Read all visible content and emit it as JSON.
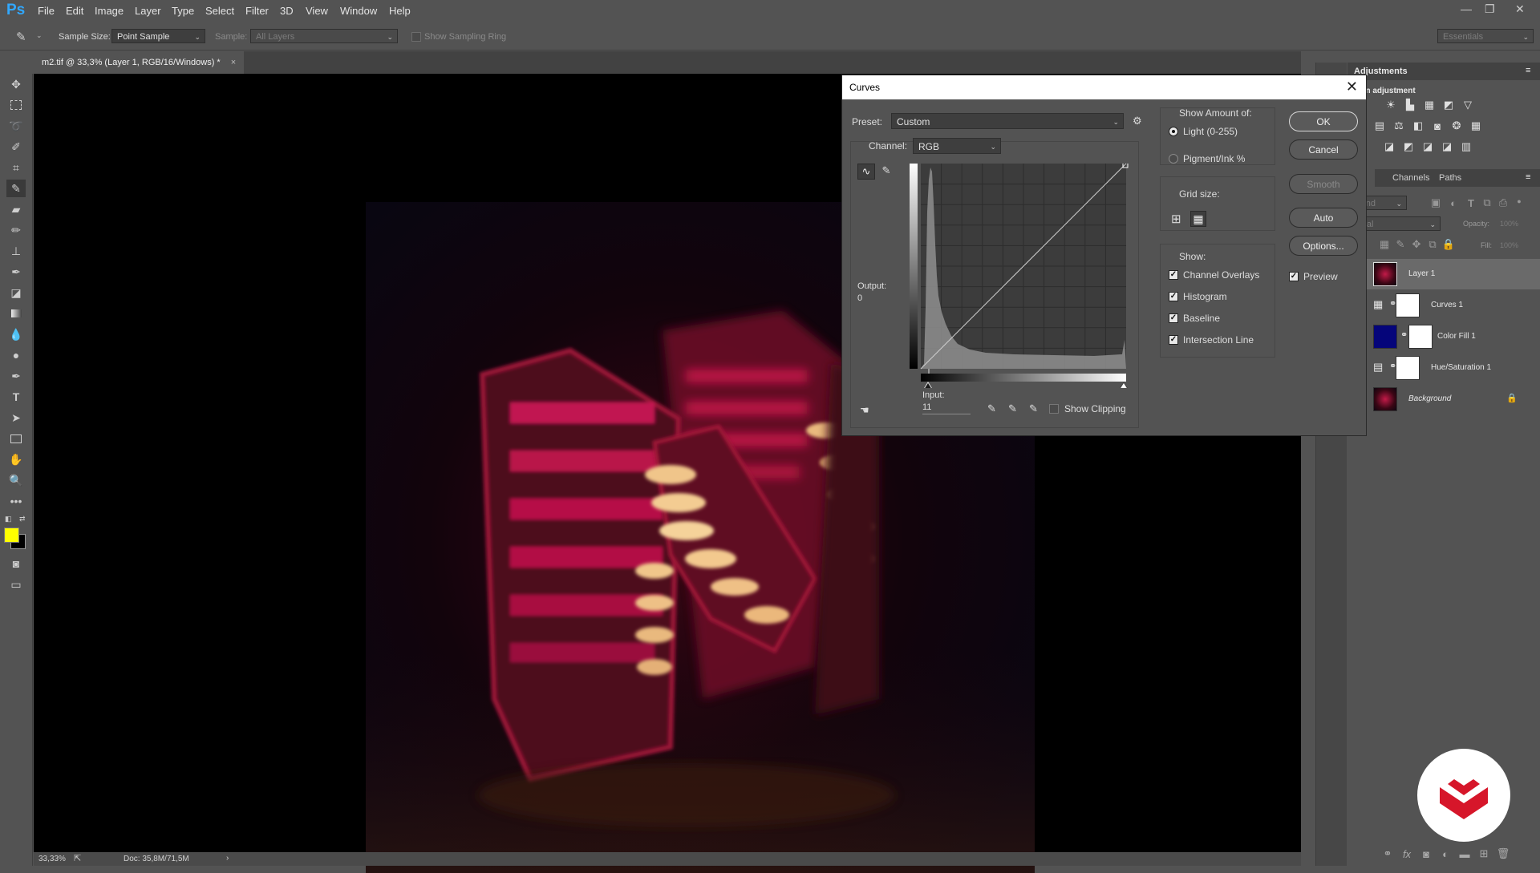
{
  "app": {
    "logo": "Ps"
  },
  "menu": [
    "File",
    "Edit",
    "Image",
    "Layer",
    "Type",
    "Select",
    "Filter",
    "3D",
    "View",
    "Window",
    "Help"
  ],
  "window_controls": {
    "minimize": "—",
    "restore": "❐",
    "close": "✕"
  },
  "options": {
    "sample_size_label": "Sample Size:",
    "sample_size_value": "Point Sample",
    "sample_label": "Sample:",
    "sample_value": "All Layers",
    "sampling_ring_label": "Show Sampling Ring",
    "workspace": "Essentials"
  },
  "document": {
    "tab_title": "m2.tif @ 33,3% (Layer 1, RGB/16/Windows) *",
    "tab_close": "×",
    "zoom": "33,33%",
    "doc_size": "Doc: 35,8M/71,5M",
    "status_arrow": "›"
  },
  "colors": {
    "foreground": "#ffff00",
    "background": "#000000",
    "accent": "#31a8ff"
  },
  "curves": {
    "title": "Curves",
    "close": "✕",
    "preset_label": "Preset:",
    "preset_value": "Custom",
    "channel_label": "Channel:",
    "channel_value": "RGB",
    "output_label": "Output:",
    "output_value": "0",
    "input_label": "Input:",
    "input_value": "11",
    "show_clipping_label": "Show Clipping",
    "show_amount_label": "Show Amount of:",
    "light_label": "Light  (0-255)",
    "pigment_label": "Pigment/Ink %",
    "grid_size_label": "Grid size:",
    "show_label": "Show:",
    "show_options": [
      {
        "label": "Channel Overlays",
        "checked": true
      },
      {
        "label": "Histogram",
        "checked": true
      },
      {
        "label": "Baseline",
        "checked": true
      },
      {
        "label": "Intersection Line",
        "checked": true
      }
    ],
    "buttons": {
      "ok": "OK",
      "cancel": "Cancel",
      "smooth": "Smooth",
      "auto": "Auto",
      "options": "Options..."
    },
    "preview_label": "Preview",
    "preview_checked": true,
    "light_selected": true
  },
  "panels": {
    "adjustments_tab": "Adjustments",
    "adjustments_hint": "d an adjustment",
    "layers_tab": "ers",
    "channels_tab": "Channels",
    "paths_tab": "Paths",
    "kind_filter": "Kind",
    "blend_mode": "rmal",
    "opacity_label": "Opacity:",
    "opacity_value": "100%",
    "fill_label": "Fill:",
    "fill_value": "100%",
    "layers": [
      {
        "name": "Layer 1",
        "selected": true
      },
      {
        "name": "Curves 1",
        "selected": false
      },
      {
        "name": "Color Fill 1",
        "selected": false
      },
      {
        "name": "Hue/Saturation 1",
        "selected": false
      },
      {
        "name": "Background",
        "selected": false
      }
    ]
  }
}
